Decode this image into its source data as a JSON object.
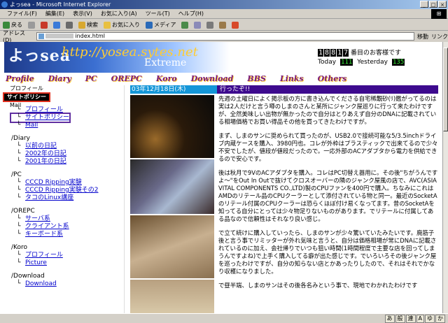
{
  "window": {
    "title": "よっsea - Microsoft Internet Explorer",
    "buttons": [
      "_",
      "□",
      "×"
    ]
  },
  "menu": [
    "ファイル(F)",
    "編集(E)",
    "表示(V)",
    "お気に入り(A)",
    "ツール(T)",
    "ヘルプ(H)"
  ],
  "toolbar": {
    "back": "戻る",
    "search": "検索",
    "favorites": "お気に入り",
    "media": "メディア"
  },
  "address": {
    "label": "アドレス(D)",
    "value": "index.html",
    "go": "移動",
    "links": "リンク"
  },
  "banner": {
    "logo": "よっsea",
    "url": "http://yosea.sytes.net",
    "sub": "Extreme"
  },
  "counter": {
    "digits": [
      "1",
      "8",
      "8",
      "1",
      "7"
    ],
    "suffix": "番目のお客様です",
    "today_label": "Today",
    "today_value": "111",
    "yesterday_label": "Yesterday",
    "yesterday_value": "135"
  },
  "nav": [
    "Profile",
    "Diary",
    "PC",
    "OREPC",
    "Koro",
    "Download",
    "BBS",
    "Links",
    "Others"
  ],
  "sidebar_top": [
    "プロフィール",
    "サイトポリシー",
    "Mail"
  ],
  "tree": [
    {
      "title": "Main",
      "leaves": [
        "プロフィール",
        "サイトポリシー",
        "Mail"
      ]
    },
    {
      "title": "/Diary",
      "leaves": [
        "以前の日記",
        "2002年の日記",
        "2001年の日記"
      ]
    },
    {
      "title": "/PC",
      "leaves": [
        "CCCD Ripping実験",
        "CCCD Ripping実験その2",
        "タコのLinux講座"
      ]
    },
    {
      "title": "/OREPC",
      "leaves": [
        "サーバ系",
        "クライアント系",
        "キーボード系"
      ]
    },
    {
      "title": "/Koro",
      "leaves": [
        "プロフィール",
        "Picture"
      ]
    },
    {
      "title": "/Download",
      "leaves": [
        "Download"
      ]
    }
  ],
  "main": {
    "date": "03年12月18日(木)",
    "topic": "行ったぞ!!",
    "paragraphs": [
      "先週の土曜日によく掲示板の方に書き込んでくださる自宅稀覯砂(ﾘ)鑑がってるのは実は2人だけと言う噂のしまのさんと某所にジャンク屋巡りに行って来たわけですが、全然美味しい出物が無かったので自分はとりあえず自分のDNAに記載されている相場価格でお買い得品その他を買ってきたわけですが。",
      "まず、しまのサンに奨められて買ったのが、USB2.0で接続可能な5/3.5inchドライブ内蔵ケースを購入、3980円也。コレが外枠はプラスティックで出来てるので少々不安でしたが、値段が値段だったので。一応外部のACアダプタから電力を供給できるので安心です。",
      "後は秋月で9VのACアダプタを購入。コレはPC切替え器用に。その後\"ちがうんですよ〜\"をOut In Outで抜けてクロスオーバーの隣のジャンク屋風の店で、AVC(ASIA VITAL COMPONENTS CO.,LTD)製のCPUファンを400円で購入。ちなみにこれはAMDのリテール品のCPUクーラーとして添付されている物と同一。最近のSocketAのリテール付属のCPUクーラーは恐らくほぼ付け易くなってます。昔のSocketAを知ってる自分にとっては少々物足りないものがあります。でリテールに付属してある品なので信頼性はそれなり良い感じ。",
      "で立て続けに購入していったら、しまのサンが少々驚いていたみたいです。廃筋子後と言う事でリミッターが外れ気味と言うと、自分は価格相場が常にDNAに記載されているのに加え、会社帰りでいつも狙い時間(1時間程度で主要な店を回ってしまうんですよね)で上手く購入してる癖が出た感じです。でいろいろその後ジャンク屋を巡ったわけですが、自分の知らない店とかあったりしたので、それはそれでかなり収穫になりました。",
      "で昼半端、しまのサンはその後各名みという事で、現地でわかれたわけです"
    ]
  },
  "status": {
    "text": "",
    "ime": [
      "あ",
      "般",
      "連",
      "A",
      "ゆ",
      "か"
    ]
  }
}
